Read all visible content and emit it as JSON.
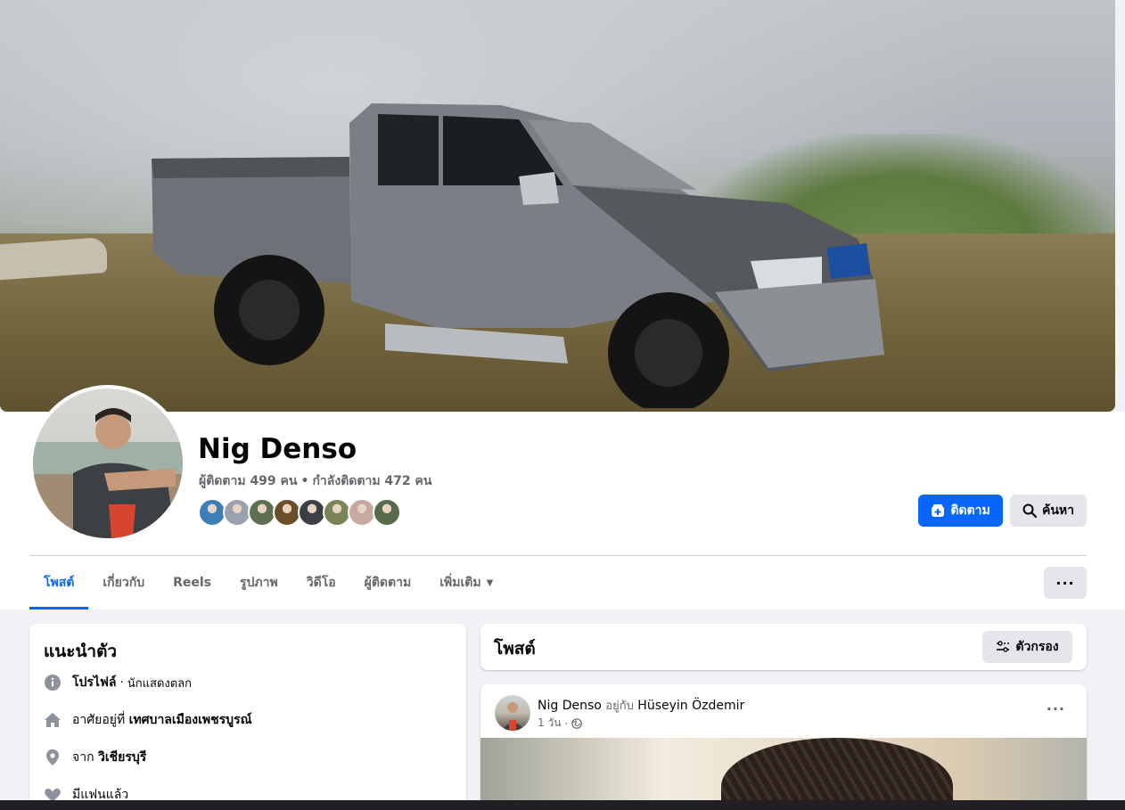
{
  "profile": {
    "name": "Nig Denso",
    "followers": "ผู้ติดตาม 499 คน",
    "separator": "•",
    "following": "กำลังติดตาม 472 คน"
  },
  "friends_avatars": [
    {
      "color": "#3b7fb6"
    },
    {
      "color": "#9aa0ad"
    },
    {
      "color": "#5f6f52"
    },
    {
      "color": "#6b4f2a"
    },
    {
      "color": "#3c3f48"
    },
    {
      "color": "#7a8457"
    },
    {
      "color": "#c7a9a2"
    },
    {
      "color": "#586a4a"
    }
  ],
  "actions": {
    "follow_label": "ติดตาม",
    "search_label": "ค้นหา",
    "more_label": "···"
  },
  "tabs": [
    {
      "label": "โพสต์",
      "active": true
    },
    {
      "label": "เกี่ยวกับ"
    },
    {
      "label": "Reels"
    },
    {
      "label": "รูปภาพ"
    },
    {
      "label": "วิดีโอ"
    },
    {
      "label": "ผู้ติดตาม"
    },
    {
      "label": "เพิ่มเติม"
    }
  ],
  "intro": {
    "title": "แนะนำตัว",
    "profile_label": "โปรไฟล์",
    "profile_sep": " · ",
    "profile_category": "นักแสดงตลก",
    "lives_prefix": "อาศัยอยู่ที่ ",
    "lives_place": "เทศบาลเมืองเพชรบูรณ์",
    "from_prefix": "จาก ",
    "from_place": "วิเชียรบุรี",
    "relationship": "มีแฟนแล้ว"
  },
  "posts": {
    "title": "โพสต์",
    "filter_label": "ตัวกรอง"
  },
  "post": {
    "author": "Nig Denso",
    "with_text": "อยู่กับ",
    "tagged": "Hüseyin Özdemir",
    "time": "1 วัน",
    "meta_sep": "·",
    "more": "···"
  },
  "colors": {
    "accent": "#0866ff",
    "secondary_btn": "#e4e6eb",
    "muted_text": "#65676b"
  }
}
